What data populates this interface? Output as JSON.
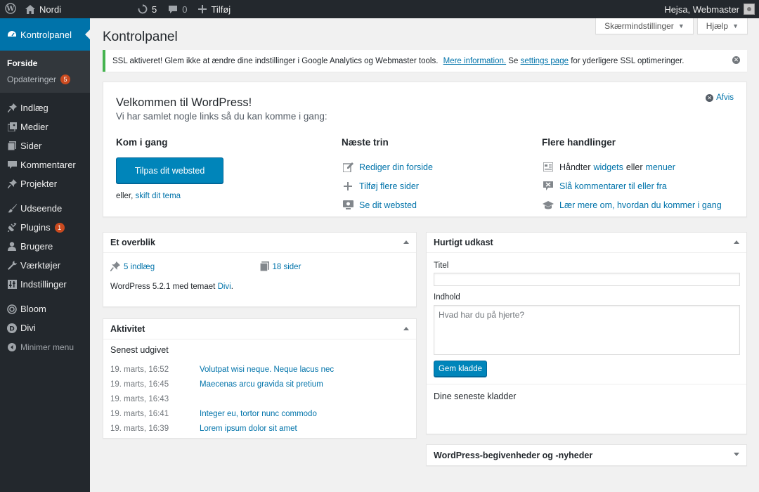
{
  "adminbar": {
    "site_name": "Nordi",
    "updates_count": "5",
    "comments_count": "0",
    "new_label": "Tilføj",
    "greeting": "Hejsa, Webmaster"
  },
  "sidebar": {
    "dashboard": "Kontrolpanel",
    "submenu": [
      {
        "label": "Forside"
      },
      {
        "label": "Opdateringer",
        "badge": "5"
      }
    ],
    "items": [
      {
        "label": "Indlæg",
        "icon": "pin-icon"
      },
      {
        "label": "Medier",
        "icon": "media-icon"
      },
      {
        "label": "Sider",
        "icon": "pages-icon"
      },
      {
        "label": "Kommentarer",
        "icon": "comments-icon"
      },
      {
        "label": "Projekter",
        "icon": "pin-icon"
      },
      {
        "label": "Udseende",
        "icon": "brush-icon"
      },
      {
        "label": "Plugins",
        "icon": "plugin-icon",
        "badge": "1"
      },
      {
        "label": "Brugere",
        "icon": "users-icon"
      },
      {
        "label": "Værktøjer",
        "icon": "wrench-icon"
      },
      {
        "label": "Indstillinger",
        "icon": "settings-icon"
      },
      {
        "label": "Bloom",
        "icon": "bloom-icon"
      },
      {
        "label": "Divi",
        "icon": "divi-icon"
      }
    ],
    "collapse": "Minimer menu"
  },
  "screen_options": "Skærmindstillinger",
  "help": "Hjælp",
  "page_title": "Kontrolpanel",
  "notice": {
    "text_before": "SSL aktiveret!  Glem ikke at ændre dine indstillinger i Google Analytics og Webmaster tools.",
    "link1": "Mere information.",
    "text_mid": " Se ",
    "link2": "settings page",
    "text_after": " for yderligere SSL optimeringer."
  },
  "welcome": {
    "title": "Velkommen til WordPress!",
    "about": "Vi har samlet nogle links så du kan komme i gang:",
    "dismiss": "Afvis",
    "col1": {
      "heading": "Kom i gang",
      "button": "Tilpas dit websted",
      "alt_prefix": "eller,",
      "alt_link": "skift dit tema"
    },
    "col2": {
      "heading": "Næste trin",
      "links": [
        "Rediger din forside",
        "Tilføj flere sider",
        "Se dit websted"
      ]
    },
    "col3": {
      "heading": "Flere handlinger",
      "widgets_prefix": "Håndter",
      "widgets_link": "widgets",
      "widgets_mid": "eller",
      "menus_link": "menuer",
      "comments_link": "Slå kommentarer til eller fra",
      "learn_link": "Lær mere om, hvordan du kommer i gang"
    }
  },
  "glance": {
    "title": "Et overblik",
    "posts": "5 indlæg",
    "pages": "18 sider",
    "footer_prefix": "WordPress 5.2.1 med temaet",
    "theme": "Divi",
    "footer_suffix": "."
  },
  "activity": {
    "title": "Aktivitet",
    "subhead": "Senest udgivet",
    "rows": [
      {
        "date": "19. marts, 16:52",
        "title": "Volutpat wisi neque. Neque lacus nec"
      },
      {
        "date": "19. marts, 16:45",
        "title": "Maecenas arcu gravida sit pretium"
      },
      {
        "date": "19. marts, 16:43",
        "title": ""
      },
      {
        "date": "19. marts, 16:41",
        "title": "Integer eu, tortor nunc commodo"
      },
      {
        "date": "19. marts, 16:39",
        "title": "Lorem ipsum dolor sit amet"
      }
    ]
  },
  "quickdraft": {
    "title": "Hurtigt udkast",
    "title_label": "Titel",
    "content_label": "Indhold",
    "content_placeholder": "Hvad har du på hjerte?",
    "save_button": "Gem kladde",
    "recent": "Dine seneste kladder"
  },
  "events": {
    "title": "WordPress-begivenheder og -nyheder"
  }
}
